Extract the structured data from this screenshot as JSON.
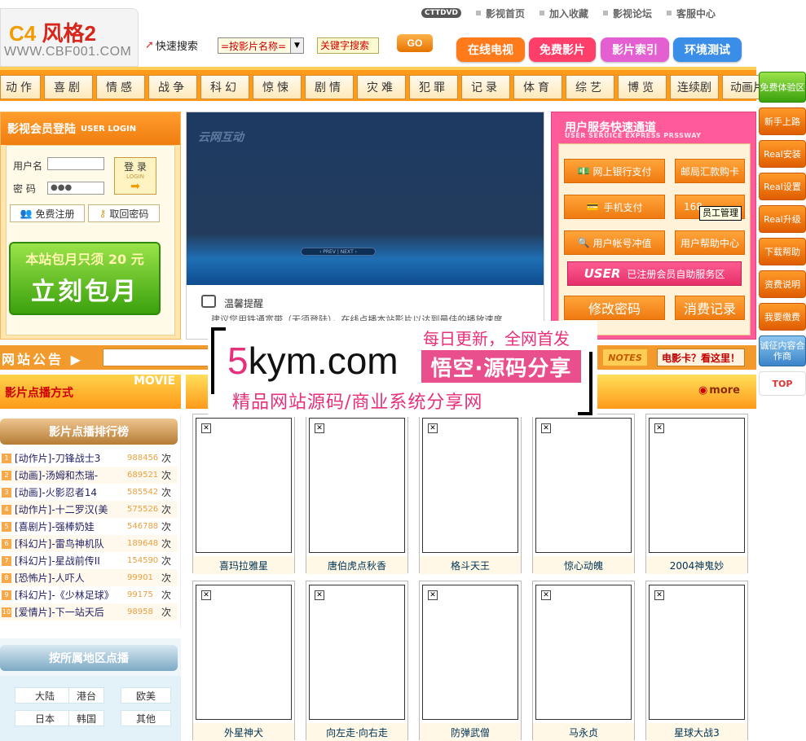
{
  "top_links": {
    "tag": "CTTDVD",
    "items": [
      "影视首页",
      "加入收藏",
      "影视论坛",
      "客服中心"
    ]
  },
  "logo": {
    "brand_prefix": "C4",
    "brand_name": "风格2",
    "url": "WWW.CBF001.COM"
  },
  "search": {
    "label": "快速搜索",
    "select_value": "=按影片名称=",
    "keyword_placeholder": "关键字搜索",
    "go_label": "GO"
  },
  "nav_buttons": [
    {
      "label": "在线电视",
      "color": "#ff7a1a"
    },
    {
      "label": "免费影片",
      "color": "#ff3f6a"
    },
    {
      "label": "影片索引",
      "color": "#e35fd2"
    },
    {
      "label": "环境测试",
      "color": "#3b8ee8"
    }
  ],
  "categories": [
    "动作",
    "喜剧",
    "情感",
    "战争",
    "科幻",
    "惊悚",
    "剧情",
    "灾难",
    "犯罪",
    "记录",
    "体育",
    "综艺",
    "博览",
    "连续剧",
    "动画片"
  ],
  "side_nav": [
    "免费体验区",
    "新手上路",
    "Real安装",
    "Real设置",
    "Real升级",
    "下载帮助",
    "资费说明",
    "我要缴费",
    "诚征内容合作商",
    "TOP"
  ],
  "login": {
    "title": "影视会员登陆",
    "title_en": "USER LOGIN",
    "username_label": "用户名",
    "password_label": "密 码",
    "password_value": "●●●",
    "login_label": "登 录",
    "login_sub": "LOGIN",
    "register_label": "免费注册",
    "recover_label": "取回密码",
    "promo_line1": "本站包月只须 20 元",
    "promo_line2": "立刻包月"
  },
  "video": {
    "brand": "云网互动",
    "pager": "‹ PREV | NEXT ›",
    "tip_title": "温馨提醒",
    "tip_text": "建议您用铁通宽带（无须登陆），在线点播本站影片以达到最佳的播放速度"
  },
  "service": {
    "title": "用户服务快速通道",
    "title_en": "USER SERUICE EXPRESS PRSSWAY",
    "items": [
      "网上银行支付",
      "邮局汇款购卡",
      "手机支付",
      "168",
      "用户帐号冲值",
      "用户帮助中心"
    ],
    "user_bar": "已注册会员自助服务区",
    "user_bar_logo": "USER",
    "change_password": "修改密码",
    "consume_record": "消费记录",
    "tooltip": "员工管理"
  },
  "notice": {
    "label": "网站公告",
    "notes": "NOTES",
    "marquee": "电影卡？看这里！"
  },
  "section_left": {
    "title": "影片点播方式",
    "movie_tag": "MOVIE"
  },
  "section_right": {
    "more": "more"
  },
  "ranking": {
    "title": "影片点播排行榜",
    "unit": "次",
    "items": [
      {
        "n": "1",
        "title": "[动作片]-刀锋战士3",
        "count": "988456"
      },
      {
        "n": "2",
        "title": "[动画]-汤姆和杰瑞-",
        "count": "689521"
      },
      {
        "n": "3",
        "title": "[动画]-火影忍者14",
        "count": "585542"
      },
      {
        "n": "4",
        "title": "[动作片]-十二罗汉(美",
        "count": "575526"
      },
      {
        "n": "5",
        "title": "[喜剧片]-强棒奶娃",
        "count": "546788"
      },
      {
        "n": "6",
        "title": "[科幻片]-雷鸟神机队",
        "count": "189648"
      },
      {
        "n": "7",
        "title": "[科幻片]-星战前传II",
        "count": "154590"
      },
      {
        "n": "8",
        "title": "[恐怖片]-人吓人",
        "count": "99901"
      },
      {
        "n": "9",
        "title": "[科幻片]-《少林足球》",
        "count": "99175"
      },
      {
        "n": "10",
        "title": "[爱情片]-下一站天后",
        "count": "98958"
      }
    ]
  },
  "region": {
    "title": "按所属地区点播",
    "items": [
      "大陆",
      "港台",
      "欧美",
      "日本",
      "韩国",
      "其他"
    ]
  },
  "posters": [
    "喜玛拉雅星",
    "唐伯虎点秋香",
    "格斗天王",
    "惊心动魄",
    "2004神鬼妙",
    "外星神犬",
    "向左走·向右走",
    "防弹武僧",
    "马永贞",
    "星球大战3"
  ],
  "watermark": {
    "site_accent": "5",
    "site_rest": "kym.com",
    "update": "每日更新，全网首发",
    "badge": "悟空·源码分享",
    "subtitle": "精品网站源码/商业系统分享网"
  }
}
